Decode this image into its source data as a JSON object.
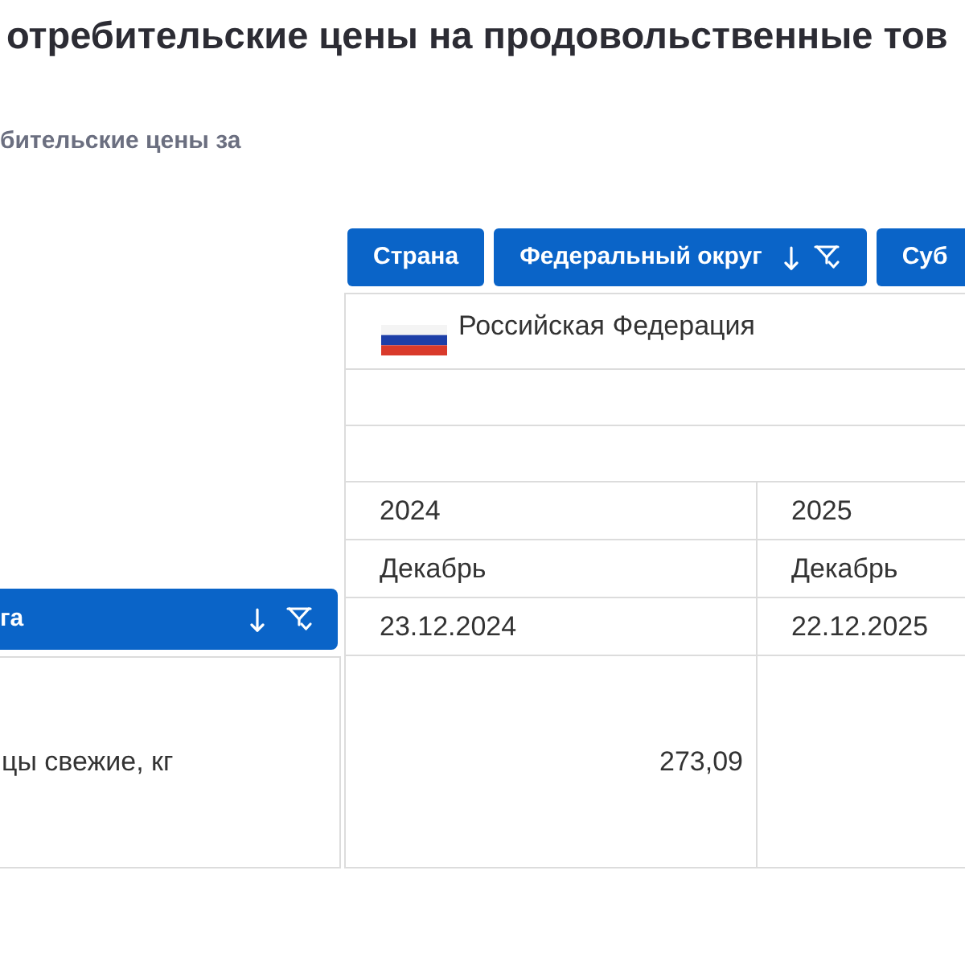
{
  "title": "отребительские цены на продовольственные тов",
  "subtitle": "бительские цены за",
  "column_filters": [
    {
      "label": "Страна",
      "sorted": false,
      "filter": false
    },
    {
      "label": "Федеральный округ",
      "sorted": true,
      "filter": true
    },
    {
      "label": "Суб"
    }
  ],
  "row_header": {
    "label": "га",
    "sorted": true,
    "filter": true
  },
  "header_rows": [
    {
      "kind": "country",
      "text": "Российская Федерация"
    },
    {
      "kind": "blank"
    },
    {
      "kind": "blank"
    },
    {
      "kind": "split",
      "cells": [
        "2024",
        "2025"
      ]
    },
    {
      "kind": "split",
      "cells": [
        "Декабрь",
        "Декабрь"
      ]
    },
    {
      "kind": "split",
      "cells": [
        "23.12.2024",
        "22.12.2025"
      ]
    }
  ],
  "rows": [
    {
      "label": "цы свежие, кг",
      "values": [
        "273,09"
      ]
    }
  ]
}
